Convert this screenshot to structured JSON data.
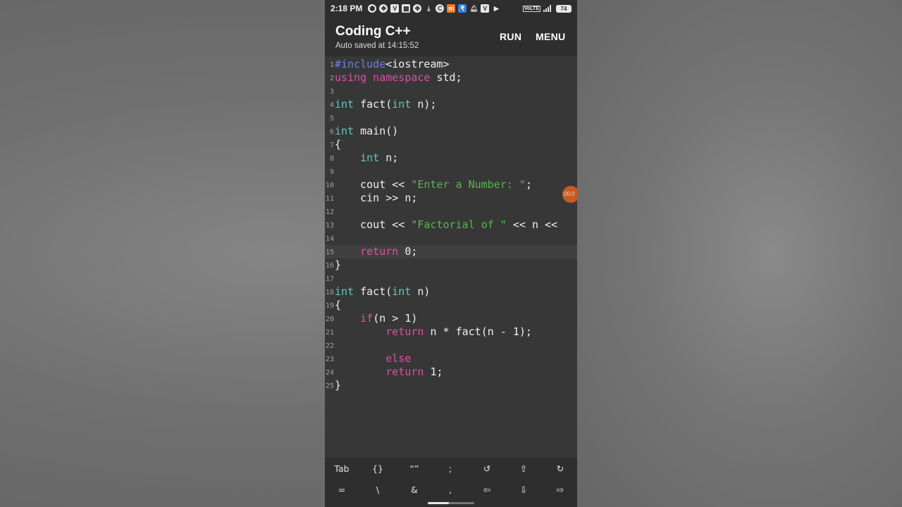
{
  "status_bar": {
    "time": "2:18 PM",
    "battery": "74",
    "network": "VoLTE",
    "icons": [
      "shield-icon",
      "grid-icon",
      "v-icon",
      "calendar-icon",
      "grid-icon",
      "download-icon",
      "c-icon",
      "mi-icon",
      "pay-icon",
      "bell-icon",
      "v-icon",
      "video-icon"
    ]
  },
  "app_bar": {
    "title": "Coding C++",
    "subtitle": "Auto saved at 14:15:52",
    "run_label": "RUN",
    "menu_label": "MENU"
  },
  "editor": {
    "active_line": 15,
    "colors": {
      "keyword": "#5fc8c4",
      "control": "#e04fa5",
      "preprocessor": "#6b80e6",
      "string": "#56b84b",
      "plain": "#f0f0f0"
    },
    "lines": [
      {
        "n": "1",
        "tokens": [
          {
            "t": "#include",
            "c": "pp"
          },
          {
            "t": "<iostream>",
            "c": "plain"
          }
        ]
      },
      {
        "n": "2",
        "tokens": [
          {
            "t": "using namespace",
            "c": "ctl"
          },
          {
            "t": " std;",
            "c": "plain"
          }
        ]
      },
      {
        "n": "3",
        "tokens": []
      },
      {
        "n": "4",
        "tokens": [
          {
            "t": "int",
            "c": "kw"
          },
          {
            "t": " fact(",
            "c": "plain"
          },
          {
            "t": "int",
            "c": "kw"
          },
          {
            "t": " n);",
            "c": "plain"
          }
        ]
      },
      {
        "n": "5",
        "tokens": []
      },
      {
        "n": "6",
        "tokens": [
          {
            "t": "int",
            "c": "kw"
          },
          {
            "t": " main()",
            "c": "plain"
          }
        ]
      },
      {
        "n": "7",
        "tokens": [
          {
            "t": "{",
            "c": "plain"
          }
        ]
      },
      {
        "n": "8",
        "tokens": [
          {
            "t": "    ",
            "c": "plain"
          },
          {
            "t": "int",
            "c": "kw"
          },
          {
            "t": " n;",
            "c": "plain"
          }
        ]
      },
      {
        "n": "9",
        "tokens": []
      },
      {
        "n": "10",
        "tokens": [
          {
            "t": "    cout << ",
            "c": "plain"
          },
          {
            "t": "\"Enter a Number: \"",
            "c": "str"
          },
          {
            "t": ";",
            "c": "plain"
          }
        ]
      },
      {
        "n": "11",
        "tokens": [
          {
            "t": "    cin >> n;",
            "c": "plain"
          }
        ]
      },
      {
        "n": "12",
        "tokens": []
      },
      {
        "n": "13",
        "tokens": [
          {
            "t": "    cout << ",
            "c": "plain"
          },
          {
            "t": "\"Factorial of \"",
            "c": "str"
          },
          {
            "t": " << n <<",
            "c": "plain"
          }
        ]
      },
      {
        "n": "14",
        "tokens": []
      },
      {
        "n": "15",
        "tokens": [
          {
            "t": "    ",
            "c": "plain"
          },
          {
            "t": "return",
            "c": "ctl"
          },
          {
            "t": " 0;",
            "c": "plain"
          }
        ]
      },
      {
        "n": "16",
        "tokens": [
          {
            "t": "}",
            "c": "plain"
          }
        ]
      },
      {
        "n": "17",
        "tokens": []
      },
      {
        "n": "18",
        "tokens": [
          {
            "t": "int",
            "c": "kw"
          },
          {
            "t": " fact(",
            "c": "plain"
          },
          {
            "t": "int",
            "c": "kw"
          },
          {
            "t": " n)",
            "c": "plain"
          }
        ]
      },
      {
        "n": "19",
        "tokens": [
          {
            "t": "{",
            "c": "plain"
          }
        ]
      },
      {
        "n": "20",
        "tokens": [
          {
            "t": "    ",
            "c": "plain"
          },
          {
            "t": "if",
            "c": "ctl"
          },
          {
            "t": "(n > 1)",
            "c": "plain"
          }
        ]
      },
      {
        "n": "21",
        "tokens": [
          {
            "t": "        ",
            "c": "plain"
          },
          {
            "t": "return",
            "c": "ctl"
          },
          {
            "t": " n * fact(n - 1);",
            "c": "plain"
          }
        ]
      },
      {
        "n": "22",
        "tokens": []
      },
      {
        "n": "23",
        "tokens": [
          {
            "t": "        ",
            "c": "plain"
          },
          {
            "t": "else",
            "c": "ctl"
          }
        ]
      },
      {
        "n": "24",
        "tokens": [
          {
            "t": "        ",
            "c": "plain"
          },
          {
            "t": "return",
            "c": "ctl"
          },
          {
            "t": " 1;",
            "c": "plain"
          }
        ]
      },
      {
        "n": "25",
        "tokens": [
          {
            "t": "}",
            "c": "plain"
          }
        ]
      }
    ]
  },
  "float_bubble": "00:0",
  "symbol_bar": {
    "row1": [
      {
        "label": "Tab",
        "name": "tab-key"
      },
      {
        "label": "{}",
        "name": "braces-key"
      },
      {
        "label": "“”",
        "name": "quotes-key"
      },
      {
        "label": ";",
        "name": "semicolon-key"
      },
      {
        "label": "↺",
        "name": "undo-icon"
      },
      {
        "label": "⇧",
        "name": "cursor-up-icon"
      },
      {
        "label": "↻",
        "name": "redo-icon"
      }
    ],
    "row2": [
      {
        "label": "=",
        "name": "equals-key"
      },
      {
        "label": "\\",
        "name": "backslash-key"
      },
      {
        "label": "&",
        "name": "ampersand-key"
      },
      {
        "label": ",",
        "name": "comma-key"
      },
      {
        "label": "⇦",
        "name": "cursor-left-icon"
      },
      {
        "label": "⇩",
        "name": "cursor-down-icon"
      },
      {
        "label": "⇨",
        "name": "cursor-right-icon"
      }
    ]
  }
}
